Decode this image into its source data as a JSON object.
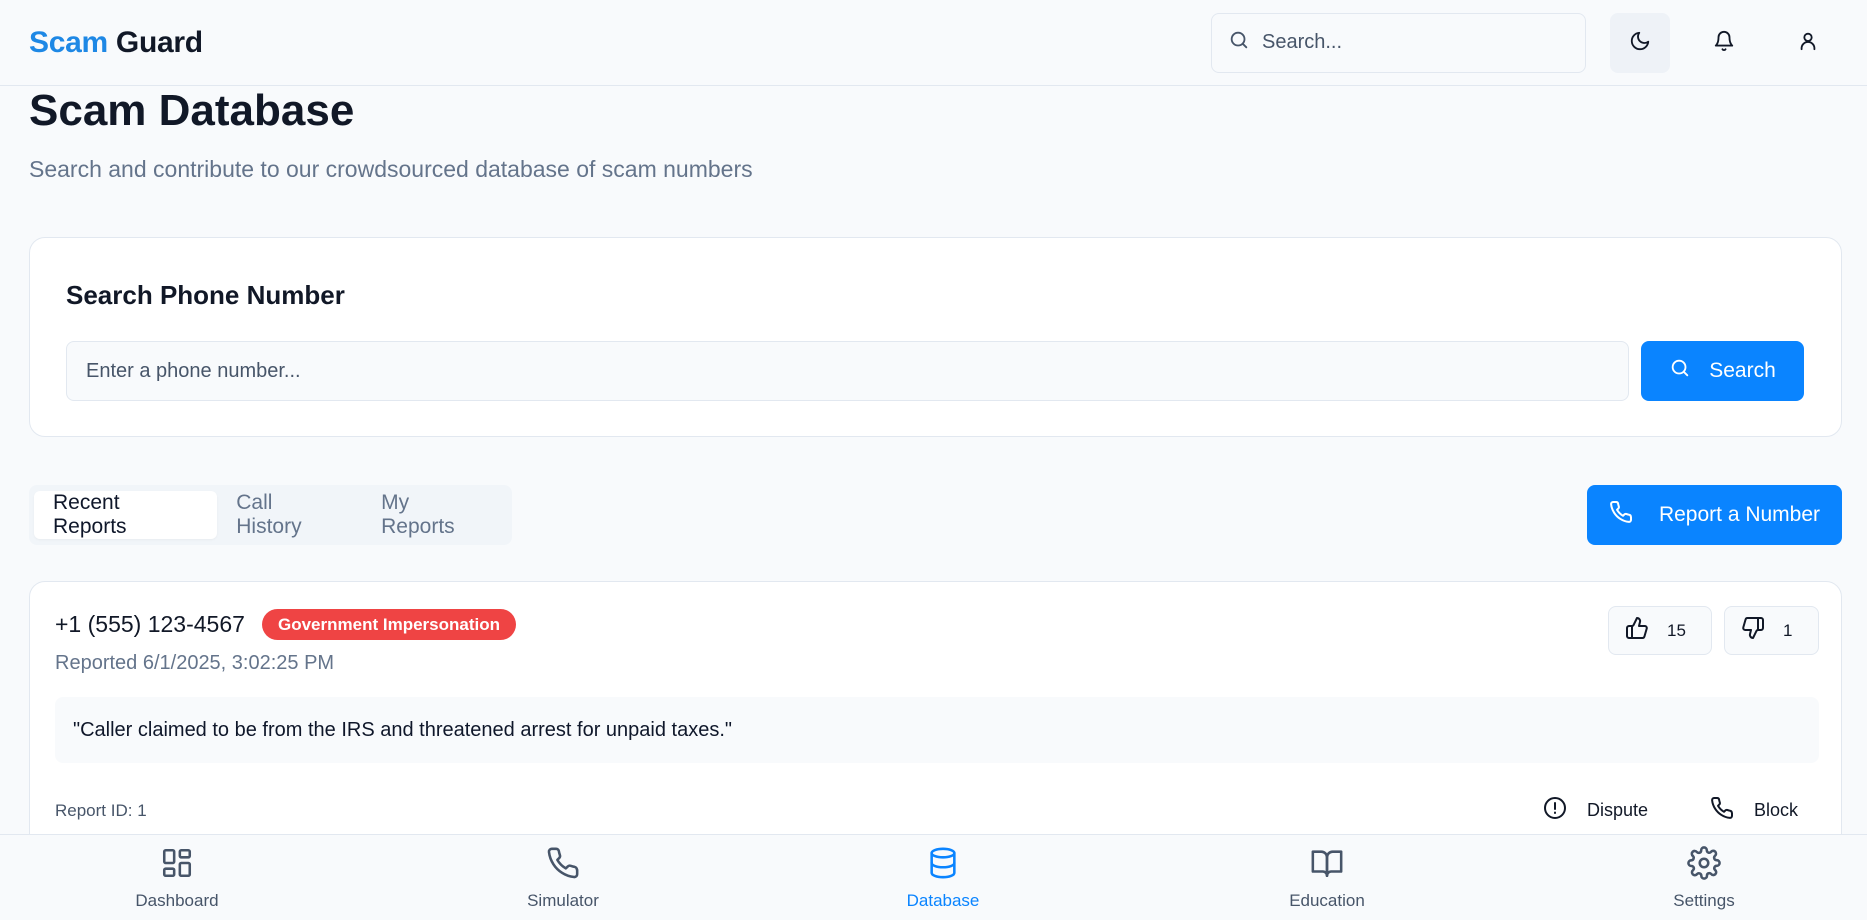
{
  "header": {
    "logo_part1": "Scam",
    "logo_part2": "Guard",
    "search_placeholder": "Search..."
  },
  "page": {
    "title": "Scam Database",
    "subtitle": "Search and contribute to our crowdsourced database of scam numbers"
  },
  "search_card": {
    "title": "Search Phone Number",
    "input_placeholder": "Enter a phone number...",
    "button_label": "Search"
  },
  "tabs": [
    {
      "label": "Recent Reports",
      "active": true
    },
    {
      "label": "Call History",
      "active": false
    },
    {
      "label": "My Reports",
      "active": false
    }
  ],
  "report_button_label": "Report a Number",
  "report": {
    "phone": "+1 (555) 123-4567",
    "category": "Government Impersonation",
    "reported": "Reported 6/1/2025, 3:02:25 PM",
    "upvotes": "15",
    "downvotes": "1",
    "comment": "\"Caller claimed to be from the IRS and threatened arrest for unpaid taxes.\"",
    "report_id": "Report ID: 1",
    "dispute_label": "Dispute",
    "block_label": "Block"
  },
  "bottom_nav": [
    {
      "label": "Dashboard",
      "icon": "dashboard-icon",
      "active": false
    },
    {
      "label": "Simulator",
      "icon": "phone-icon",
      "active": false
    },
    {
      "label": "Database",
      "icon": "database-icon",
      "active": true
    },
    {
      "label": "Education",
      "icon": "book-icon",
      "active": false
    },
    {
      "label": "Settings",
      "icon": "gear-icon",
      "active": false
    }
  ],
  "colors": {
    "accent": "#0a84ff",
    "logo_blue": "#1e88e5",
    "badge_red": "#ef4444"
  }
}
